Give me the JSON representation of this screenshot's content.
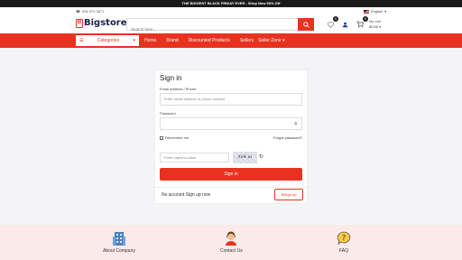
{
  "promo": "THE BIGGEST BLACK FRIDAY EVER - Shop Now 50% Off",
  "header": {
    "phone": "094 570 3877",
    "language": "English",
    "logo_text": "Bigstores",
    "search_placeholder": "Search here...",
    "wishlist_count": "0",
    "cart_count": "0",
    "cart_label": "My cart",
    "cart_amount": "¥0.00"
  },
  "nav": {
    "categories_label": "Categories",
    "links": [
      "Home",
      "Brand",
      "Discounted Products",
      "Sellers",
      "Seller Zone"
    ]
  },
  "signin": {
    "title": "Sign in",
    "email_label": "Email address / Phone",
    "email_placeholder": "Enter email address or phone number",
    "password_label": "Password",
    "remember_label": "Remember me",
    "forgot_label": "Forgot password?",
    "captcha_placeholder": "Enter captcha value",
    "captcha_text": "ʎɐ4 uı",
    "signin_button": "Sign in",
    "no_account": "No account Sign up now",
    "signup_button": "Sign up"
  },
  "footer": {
    "items": [
      {
        "label": "About Company",
        "icon": "building-icon"
      },
      {
        "label": "Contact Us",
        "icon": "support-agent-icon"
      },
      {
        "label": "FAQ",
        "icon": "question-bubble-icon"
      }
    ]
  },
  "colors": {
    "accent": "#e8321f",
    "topbar": "#1a1a1a",
    "footer_bg": "#fbeaea"
  }
}
